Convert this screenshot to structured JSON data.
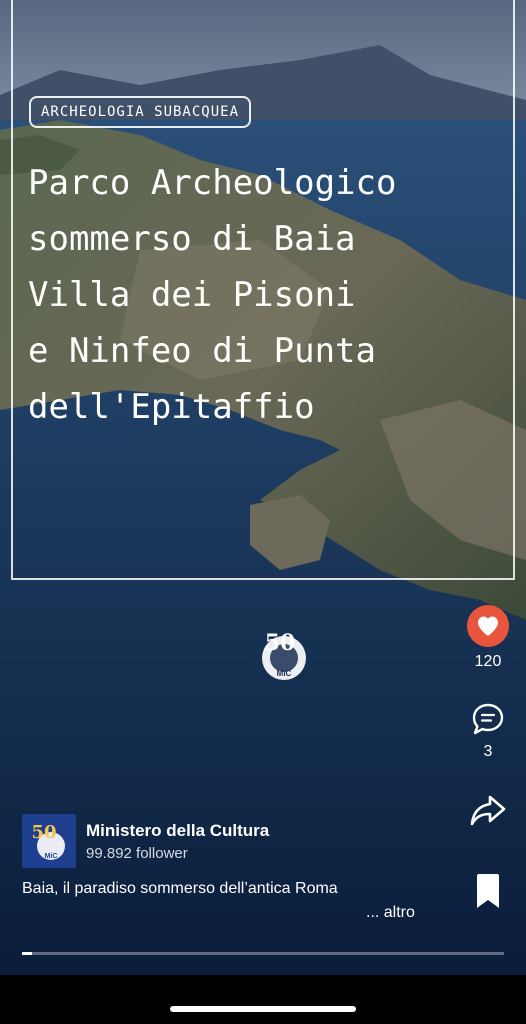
{
  "post": {
    "category_tag": "ARCHEOLOGIA SUBACQUEA",
    "title": "Parco Archeologico\nsommerso di Baia\nVilla dei Pisoni\ne Ninfeo di Punta\ndell'Epitaffio",
    "overlay_logo_text": "50",
    "overlay_logo_sub": "MiC"
  },
  "actions": {
    "like_count": "120",
    "comment_count": "3",
    "like_color": "#e8553c"
  },
  "author": {
    "name": "Ministero della Cultura",
    "followers": "99.892 follower",
    "avatar_text": "50",
    "avatar_sub": "MiC"
  },
  "caption": {
    "text": "Baia, il paradiso sommerso dell’antica Roma",
    "more_label": "... altro"
  },
  "playback": {
    "progress": 0.02
  },
  "icons": [
    "heart-icon",
    "comment-icon",
    "share-icon",
    "bookmark-icon"
  ]
}
